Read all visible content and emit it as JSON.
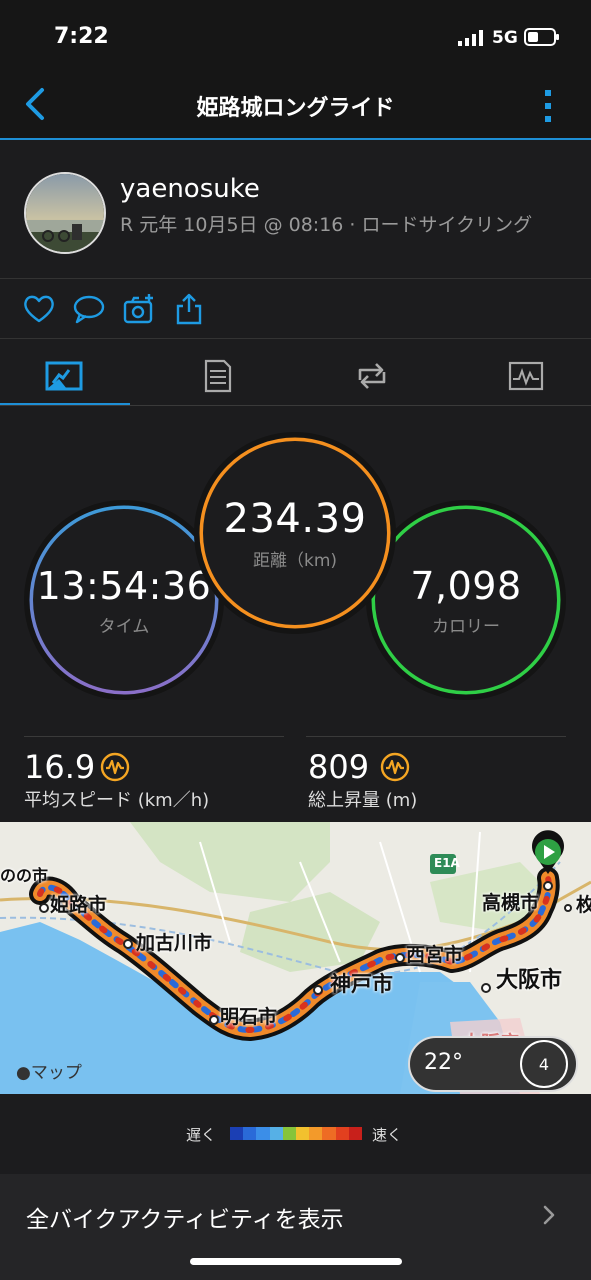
{
  "status": {
    "time": "7:22",
    "network": "5G"
  },
  "nav": {
    "title": "姫路城ロングライド"
  },
  "profile": {
    "username": "yaenosuke",
    "subtitle": "R 元年 10月5日 @ 08:16 · ロードサイクリング"
  },
  "metrics": {
    "time": {
      "value": "13:54:36",
      "label": "タイム"
    },
    "distance": {
      "value": "234.39",
      "label": "距離（km)"
    },
    "calories": {
      "value": "7,098",
      "label": "カロリー"
    }
  },
  "stats": {
    "avg_speed": {
      "value": "16.9",
      "label": "平均スピード (km／h)"
    },
    "elevation": {
      "value": "809",
      "label": "総上昇量 (m)"
    }
  },
  "map": {
    "labels": {
      "himeji_edge": "のの市",
      "himeji": "姫路市",
      "kakogawa": "加古川市",
      "akashi": "明石市",
      "kobe": "神戸市",
      "nishinomiya": "西宮市",
      "osaka": "大阪市",
      "takatsuki": "高槻市",
      "hirakata_edge": "枚",
      "osaka_fu": "大阪府",
      "highway": "E1A"
    },
    "credit": "マップ",
    "temperature": "22°",
    "wind": "4"
  },
  "legend": {
    "slow": "遅く",
    "fast": "速く",
    "colors": [
      "#1b3fb4",
      "#2a6ad8",
      "#3b8ee8",
      "#56b0e6",
      "#86c43a",
      "#f2c12e",
      "#f39a2a",
      "#ee6c24",
      "#e2401f",
      "#c8201b"
    ]
  },
  "footer": {
    "label": "全バイクアクティビティを表示"
  }
}
